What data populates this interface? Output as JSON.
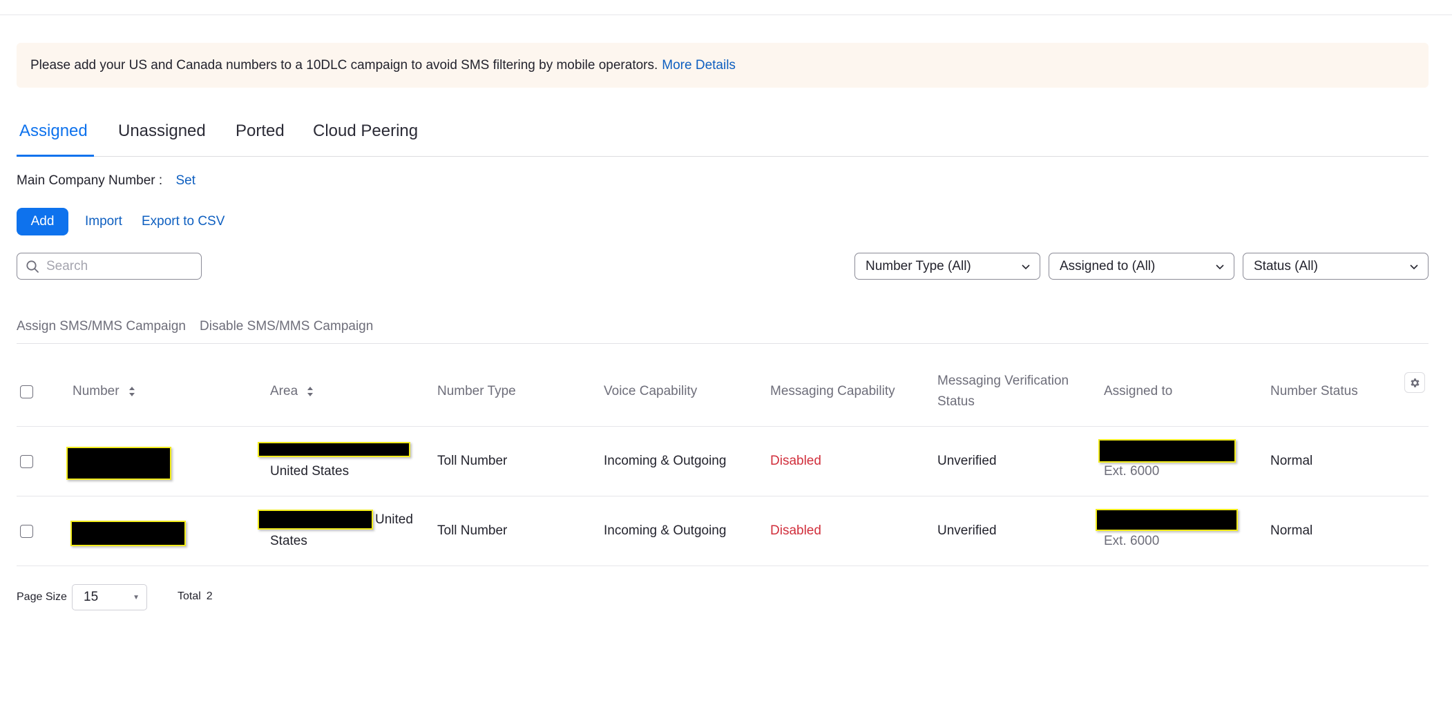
{
  "banner": {
    "text": "Please add your US and Canada numbers to a 10DLC campaign to avoid SMS filtering by mobile operators.",
    "link": "More Details"
  },
  "tabs": [
    {
      "label": "Assigned",
      "active": true
    },
    {
      "label": "Unassigned",
      "active": false
    },
    {
      "label": "Ported",
      "active": false
    },
    {
      "label": "Cloud Peering",
      "active": false
    }
  ],
  "main_company": {
    "label": "Main Company Number :",
    "action": "Set"
  },
  "actions": {
    "add": "Add",
    "import": "Import",
    "export": "Export to CSV"
  },
  "search": {
    "placeholder": "Search",
    "value": ""
  },
  "filters": [
    "Number Type (All)",
    "Assigned to (All)",
    "Status (All)"
  ],
  "bulk_actions": [
    "Assign SMS/MMS Campaign",
    "Disable SMS/MMS Campaign"
  ],
  "table": {
    "columns": [
      "Number",
      "Area",
      "Number Type",
      "Voice Capability",
      "Messaging Capability",
      "Messaging Verification",
      "Status",
      "Assigned to",
      "Number Status"
    ],
    "rows": [
      {
        "area": "United States",
        "number_type": "Toll Number",
        "voice": "Incoming & Outgoing",
        "messaging": "Disabled",
        "verification": "Unverified",
        "assigned_ext": "Ext. 6000",
        "status": "Normal"
      },
      {
        "area_line1": "United",
        "area_line2": "States",
        "number_type": "Toll Number",
        "voice": "Incoming & Outgoing",
        "messaging": "Disabled",
        "verification": "Unverified",
        "assigned_ext": "Ext. 6000",
        "status": "Normal"
      }
    ]
  },
  "pagination": {
    "page_size_label": "Page Size",
    "page_size": "15",
    "total_label": "Total",
    "total": "2"
  },
  "colors": {
    "accent": "#0e72ed",
    "link": "#0e5fc0",
    "danger": "#d12f3c",
    "banner_bg": "#fdf6ef",
    "redaction_border": "#f2ec1c"
  },
  "icons": [
    "search-icon",
    "chevron-down-icon",
    "sort-icon",
    "gear-icon",
    "caret-down-icon"
  ]
}
